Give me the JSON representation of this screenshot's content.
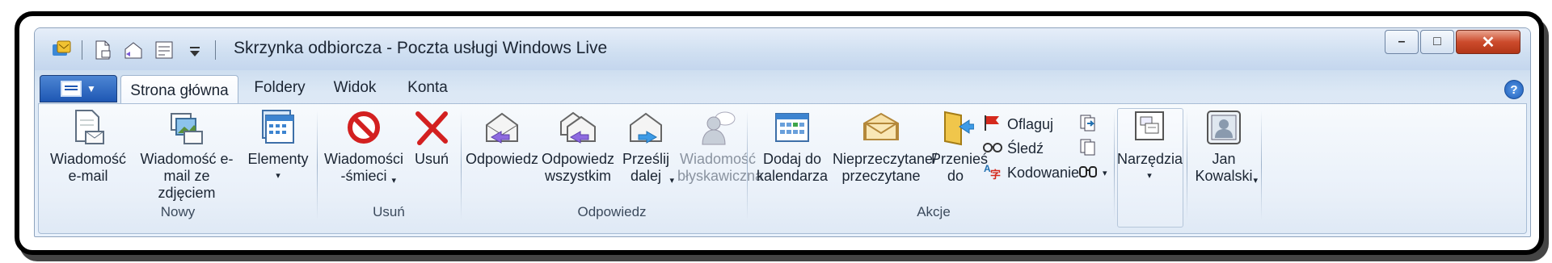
{
  "window": {
    "title": "Skrzynka odbiorcza - Poczta usługi Windows Live",
    "controls": {
      "minimize": "–",
      "maximize": "□",
      "close": "✕"
    }
  },
  "tabs": [
    {
      "label": "Strona główna",
      "active": true
    },
    {
      "label": "Foldery",
      "active": false
    },
    {
      "label": "Widok",
      "active": false
    },
    {
      "label": "Konta",
      "active": false
    }
  ],
  "help_label": "?",
  "groups": {
    "nowy": {
      "label": "Nowy",
      "buttons": [
        {
          "label": "Wiadomość\ne-mail",
          "icon": "new-email-icon"
        },
        {
          "label": "Wiadomość e-\nmail ze zdjęciem",
          "icon": "photo-email-icon"
        },
        {
          "label": "Elementy",
          "caret": "▾",
          "icon": "calendar-items-icon"
        }
      ]
    },
    "usun": {
      "label": "Usuń",
      "buttons": [
        {
          "label": "Wiadomości\n-śmieci",
          "caret": "▾",
          "icon": "junk-icon"
        },
        {
          "label": "Usuń",
          "icon": "delete-x-icon"
        }
      ]
    },
    "odpowiedz": {
      "label": "Odpowiedz",
      "buttons": [
        {
          "label": "Odpowiedz",
          "icon": "reply-icon"
        },
        {
          "label": "Odpowiedz\nwszystkim",
          "icon": "reply-all-icon"
        },
        {
          "label": "Prześlij\ndalej",
          "caret": "▾",
          "icon": "forward-icon"
        },
        {
          "label": "Wiadomość\nbłyskawiczna",
          "icon": "instant-message-icon",
          "disabled": true
        }
      ]
    },
    "akcje": {
      "label": "Akcje",
      "buttons": [
        {
          "label": "Dodaj do\nkalendarza",
          "icon": "add-calendar-icon"
        },
        {
          "label": "Nieprzeczytane/\nprzeczytane",
          "icon": "read-unread-icon"
        },
        {
          "label": "Przenieś\ndo",
          "icon": "move-folder-icon"
        }
      ],
      "small": [
        {
          "label": "Oflaguj",
          "icon": "flag-icon"
        },
        {
          "label": "Śledź",
          "icon": "glasses-icon"
        },
        {
          "label": "Kodowanie",
          "icon": "encoding-icon"
        }
      ],
      "small_icons": [
        "copy-to-icon",
        "copy-icon",
        "find-icon"
      ]
    }
  },
  "right": [
    {
      "label": "Narzędzia",
      "caret": "▾",
      "icon": "tools-icon"
    },
    {
      "label": "Jan\nKowalski",
      "caret": "▾",
      "icon": "user-avatar-icon"
    }
  ],
  "colors": {
    "accent": "#1e57b3",
    "ribbon_bg": "#e9f0f9",
    "close": "#cc4b2c"
  }
}
